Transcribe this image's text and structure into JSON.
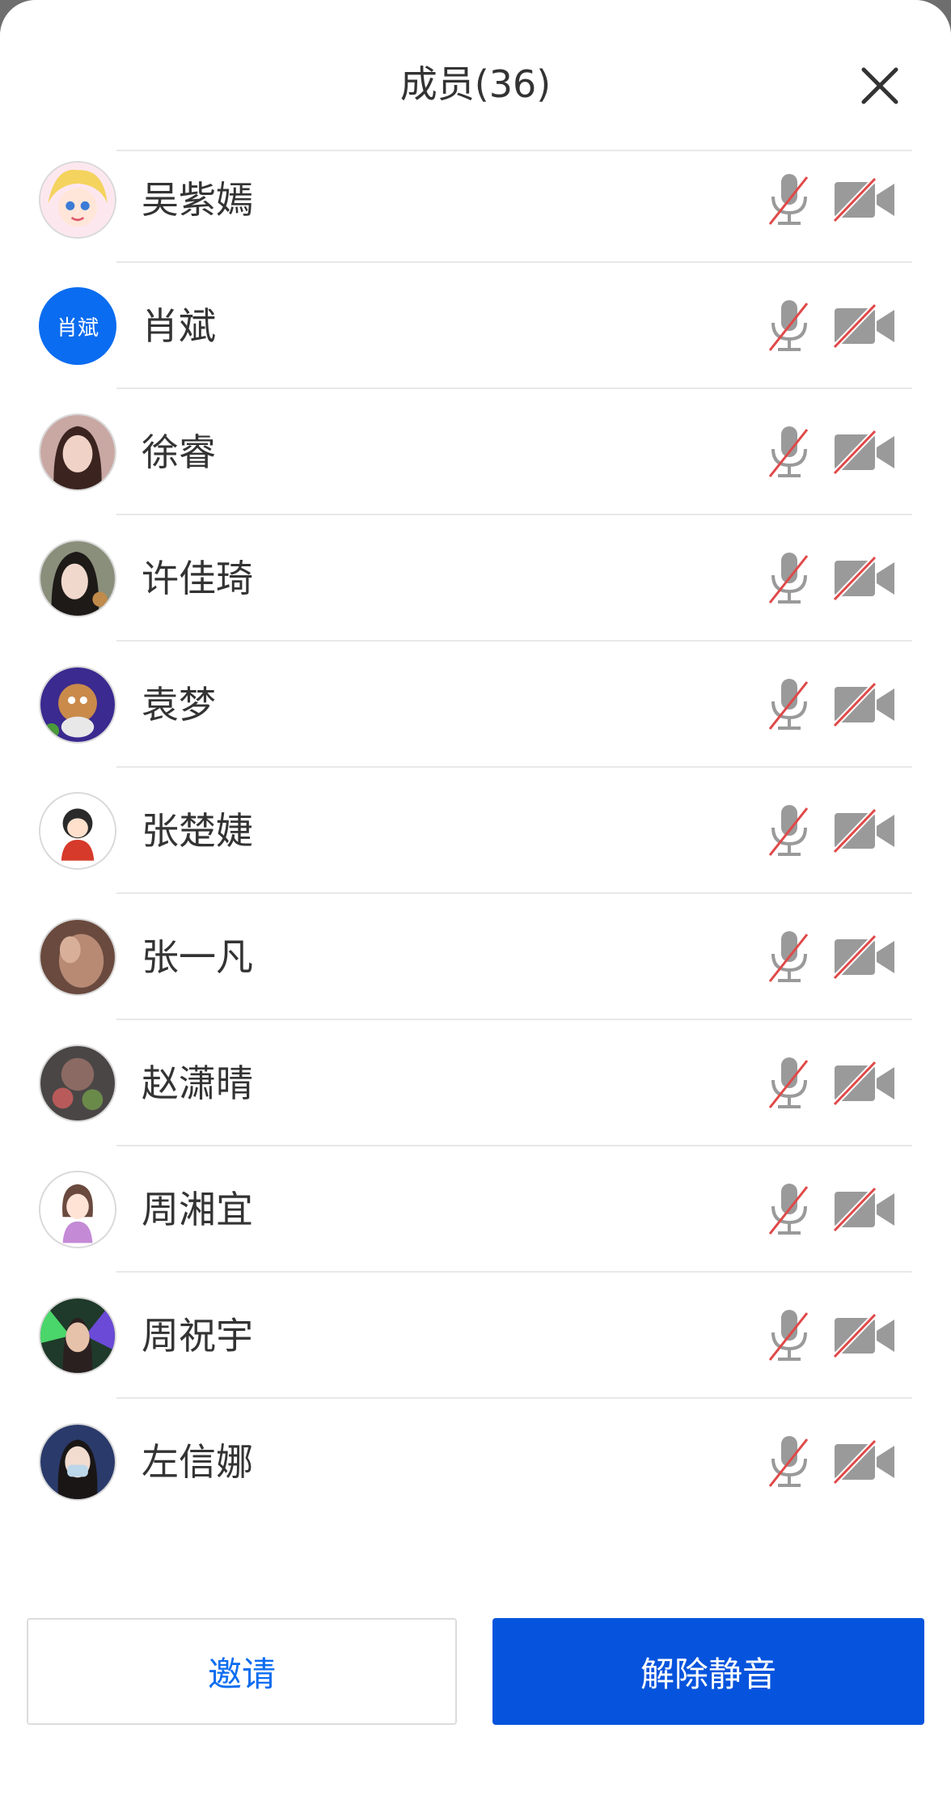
{
  "header": {
    "title": "成员(36)"
  },
  "members": [
    {
      "name": "",
      "avatar": "yellow-cartoon-avatar"
    },
    {
      "name": "吴紫嫣",
      "avatar": "anime-girl-avatar"
    },
    {
      "name": "肖斌",
      "avatar": "initials-avatar",
      "avatar_text": "肖斌"
    },
    {
      "name": "徐睿",
      "avatar": "photo-avatar"
    },
    {
      "name": "许佳琦",
      "avatar": "photo-avatar"
    },
    {
      "name": "袁梦",
      "avatar": "cartoon-avatar"
    },
    {
      "name": "张楚婕",
      "avatar": "cartoon-avatar"
    },
    {
      "name": "张一凡",
      "avatar": "photo-avatar"
    },
    {
      "name": "赵潇晴",
      "avatar": "photo-avatar"
    },
    {
      "name": "周湘宜",
      "avatar": "cartoon-avatar"
    },
    {
      "name": "周祝宇",
      "avatar": "photo-avatar"
    },
    {
      "name": "左信娜",
      "avatar": "photo-avatar"
    }
  ],
  "footer": {
    "invite_label": "邀请",
    "unmute_label": "解除静音"
  },
  "colors": {
    "accent": "#0654dd",
    "link": "#0a6cf0",
    "muted_slash": "#e04848",
    "icon_gray": "#9a9a9a"
  }
}
